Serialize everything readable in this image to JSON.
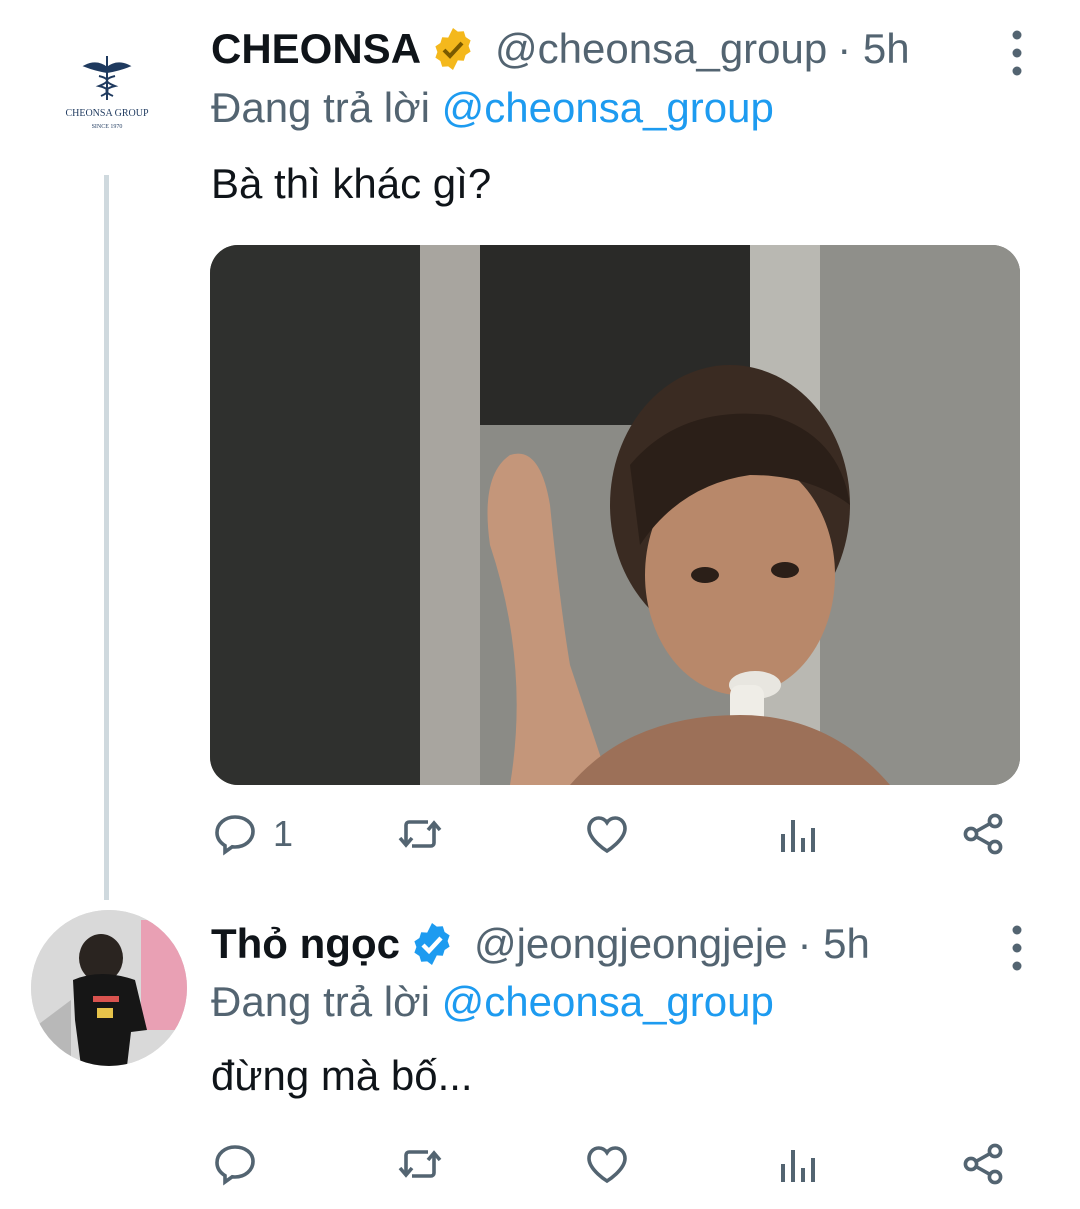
{
  "tweets": [
    {
      "author": {
        "name": "CHEONSA",
        "handle": "@cheonsa_group",
        "verified": "gold",
        "avatar_logo": {
          "line1": "CHEONSA GROUP",
          "line2": "SINCE 1970"
        }
      },
      "time": "· 5h",
      "reply_prefix": "Đang trả lời",
      "reply_to": "@cheonsa_group",
      "text": "Bà thì khác gì?",
      "media": {
        "type": "photo",
        "description": "meme photo"
      },
      "actions": {
        "reply_count": "1",
        "retweet_count": "",
        "like_count": ""
      }
    },
    {
      "author": {
        "name": "Thỏ ngọc",
        "handle": "@jeongjeongjeje",
        "verified": "blue"
      },
      "time": "· 5h",
      "reply_prefix": "Đang trả lời",
      "reply_to": "@cheonsa_group",
      "text": "đừng mà bố...",
      "actions": {
        "reply_count": "",
        "retweet_count": "",
        "like_count": ""
      }
    }
  ],
  "colors": {
    "gold_badge": "#f4b81c",
    "blue_badge": "#1d9bf0",
    "secondary_text": "#536471",
    "link": "#1d9bf0",
    "thread_line": "#cfd9de"
  }
}
